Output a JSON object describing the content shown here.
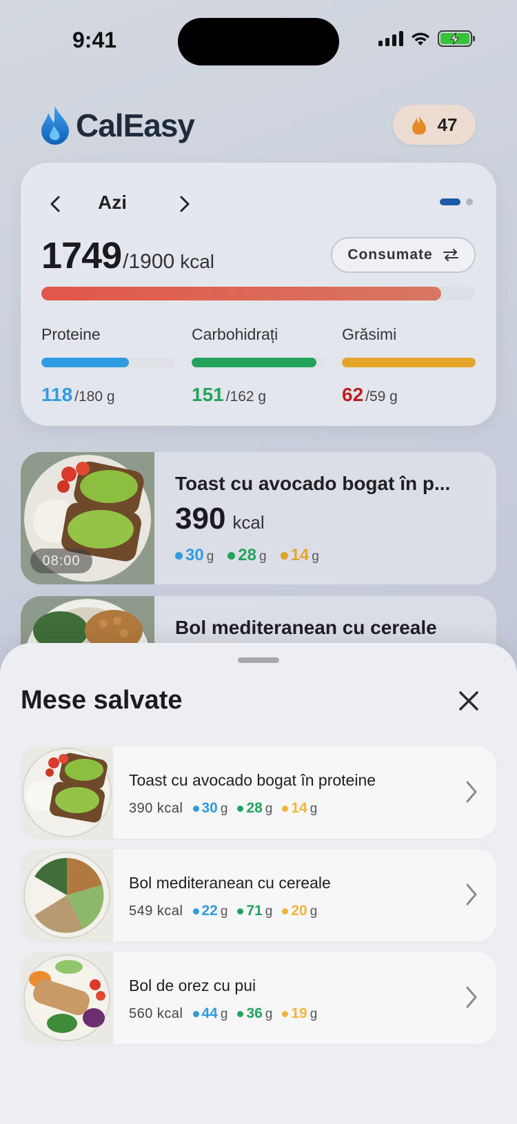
{
  "status_bar": {
    "time": "9:41"
  },
  "app": {
    "name": "CalEasy"
  },
  "streak": {
    "count": "47",
    "icon": "flame-icon",
    "color": "#e58a24"
  },
  "summary": {
    "day_label": "Azi",
    "consumed": "1749",
    "goal": "/1900",
    "unit": "kcal",
    "progress": 0.9205,
    "toggle_label": "Consumate",
    "macros": [
      {
        "name": "Proteine",
        "current": "118",
        "goal": "/180 g",
        "progress": 0.656,
        "color": "#2f9be0",
        "value_color": "#2f9be0"
      },
      {
        "name": "Carbohidrați",
        "current": "151",
        "goal": "/162 g",
        "progress": 0.932,
        "color": "#23a35c",
        "value_color": "#23a35c"
      },
      {
        "name": "Grăsimi",
        "current": "62",
        "goal": "/59 g",
        "progress": 1.0,
        "color": "#e2a52a",
        "value_color": "#b72020"
      }
    ]
  },
  "meals": [
    {
      "title": "Toast cu avocado bogat în p...",
      "kcal": "390",
      "unit": "kcal",
      "time": "08:00",
      "macros": [
        {
          "value": "30",
          "unit": "g",
          "color": "#2f9be0"
        },
        {
          "value": "28",
          "unit": "g",
          "color": "#23a35c"
        },
        {
          "value": "14",
          "unit": "g",
          "color": "#e2a52a"
        }
      ]
    },
    {
      "title": "Bol mediteranean cu cereale"
    }
  ],
  "saved_sheet": {
    "title": "Mese salvate",
    "items": [
      {
        "title": "Toast cu avocado bogat în proteine",
        "kcal": "390 kcal",
        "macros": [
          {
            "value": "30",
            "unit": "g",
            "color": "#2f9be0"
          },
          {
            "value": "28",
            "unit": "g",
            "color": "#23a35c"
          },
          {
            "value": "14",
            "unit": "g",
            "color": "#f0b43a"
          }
        ]
      },
      {
        "title": "Bol mediteranean cu cereale",
        "kcal": "549 kcal",
        "macros": [
          {
            "value": "22",
            "unit": "g",
            "color": "#2f9be0"
          },
          {
            "value": "71",
            "unit": "g",
            "color": "#23a35c"
          },
          {
            "value": "20",
            "unit": "g",
            "color": "#f0b43a"
          }
        ]
      },
      {
        "title": "Bol de orez cu pui",
        "kcal": "560 kcal",
        "macros": [
          {
            "value": "44",
            "unit": "g",
            "color": "#2f9be0"
          },
          {
            "value": "36",
            "unit": "g",
            "color": "#23a35c"
          },
          {
            "value": "19",
            "unit": "g",
            "color": "#f0b43a"
          }
        ]
      }
    ]
  }
}
